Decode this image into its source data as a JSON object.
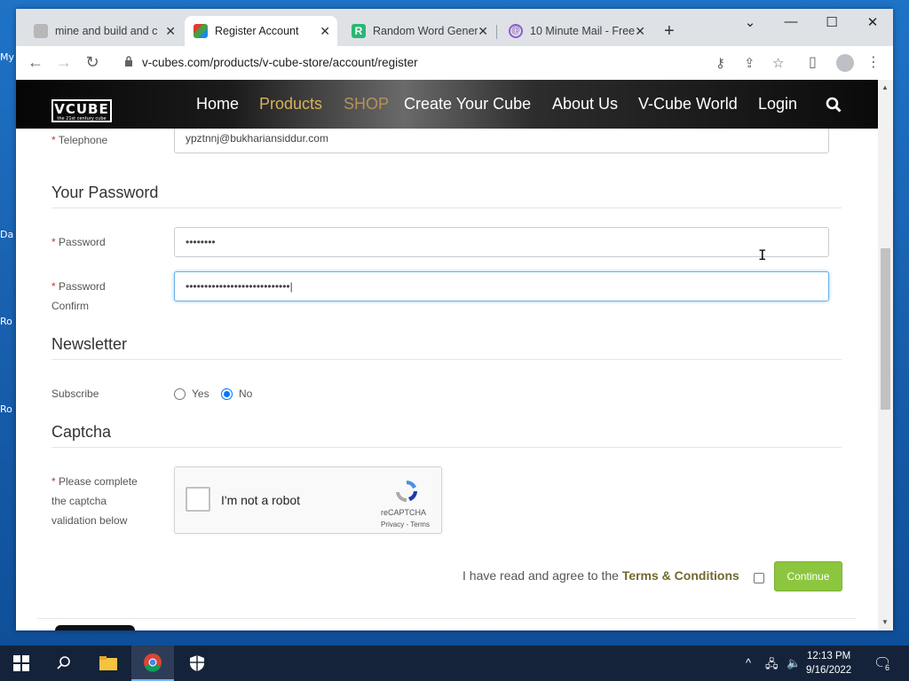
{
  "desktop": {
    "icon_labels": [
      "My",
      "Da",
      "Ro",
      "Ro"
    ]
  },
  "browser": {
    "tabs": [
      {
        "title": "mine and build and c",
        "active": false
      },
      {
        "title": "Register Account",
        "active": true
      },
      {
        "title": "Random Word Gener",
        "active": false
      },
      {
        "title": "10 Minute Mail - Free",
        "active": false
      }
    ],
    "url": "v-cubes.com/products/v-cube-store/account/register"
  },
  "site": {
    "logo": "VCUBE",
    "logo_tagline": "the 21st century cube",
    "menu": [
      "Home",
      "Products",
      "SHOP",
      "Create Your Cube",
      "About Us",
      "V-Cube World",
      "Login"
    ]
  },
  "form": {
    "telephone_label": "Telephone",
    "telephone_value": "ypztnnj@bukhariansiddur.com",
    "password_section": "Your Password",
    "password_label": "Password",
    "password_value": "••••••••",
    "confirm_label_1": "Password",
    "confirm_label_2": "Confirm",
    "confirm_value": "••••••••••••••••••••••••••••|",
    "newsletter_section": "Newsletter",
    "subscribe_label": "Subscribe",
    "subscribe_yes": "Yes",
    "subscribe_no": "No",
    "subscribe_selected": "No",
    "captcha_section": "Captcha",
    "captcha_label_1": "Please complete",
    "captcha_label_2": "the captcha",
    "captcha_label_3": "validation below",
    "captcha_text": "I'm not a robot",
    "captcha_brand": "reCAPTCHA",
    "captcha_links": "Privacy - Terms",
    "agree_text": "I have read and agree to the",
    "terms_link": "Terms & Conditions",
    "continue_label": "Continue",
    "required_marker": "*"
  },
  "taskbar": {
    "time": "12:13 PM",
    "date": "9/16/2022",
    "notifications": "6"
  },
  "colors": {
    "accent_green": "#8cc63f",
    "menu_gold": "#d9b15a",
    "terms_olive": "#6f6a2c",
    "required_red": "#c0392b"
  }
}
